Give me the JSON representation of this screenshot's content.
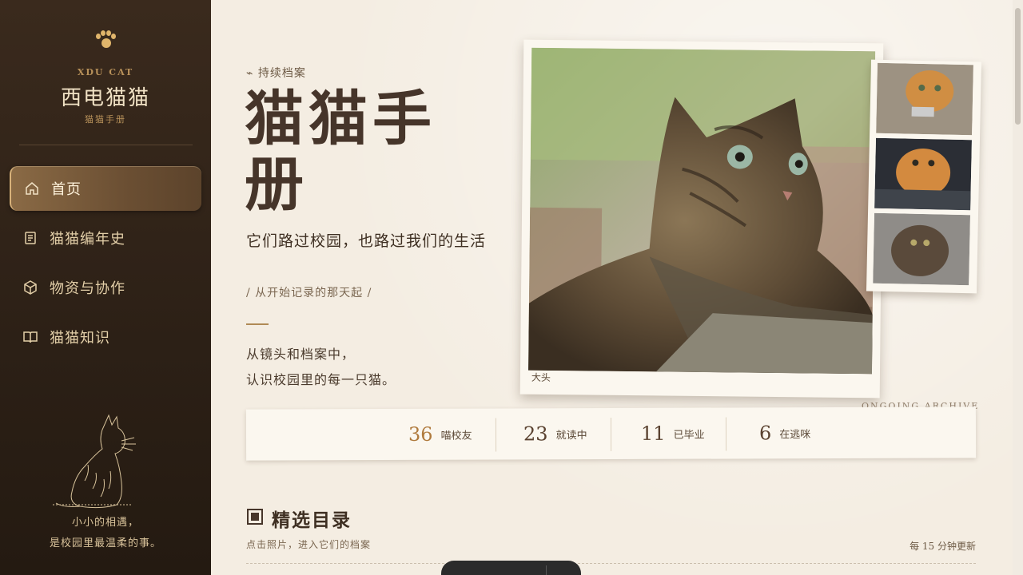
{
  "sidebar": {
    "brand_en": "XDU CAT",
    "brand_cn": "西电猫猫",
    "brand_sub": "猫猫手册",
    "nav": [
      {
        "label": "首页",
        "icon": "home-icon",
        "active": true
      },
      {
        "label": "猫猫编年史",
        "icon": "document-icon",
        "active": false
      },
      {
        "label": "物资与协作",
        "icon": "box-icon",
        "active": false
      },
      {
        "label": "猫猫知识",
        "icon": "book-icon",
        "active": false
      }
    ],
    "quote_line1": "小小的相遇，",
    "quote_line2": "是校园里最温柔的事。"
  },
  "hero": {
    "eyebrow": "⌁ 持续档案",
    "title": "猫猫手册",
    "subtitle": "它们路过校园，也路过我们的生活",
    "since": "/ 从开始记录的那天起 /",
    "desc_line1": "从镜头和档案中，",
    "desc_line2": "认识校园里的每一只猫。",
    "photo_caption": "大头",
    "archive_label": "ONGOING ARCHIVE"
  },
  "stats": [
    {
      "value": "36",
      "label": "喵校友"
    },
    {
      "value": "23",
      "label": "就读中"
    },
    {
      "value": "11",
      "label": "已毕业"
    },
    {
      "value": "6",
      "label": "在逃咪"
    }
  ],
  "section": {
    "title": "精选目录",
    "subtitle": "点击照片，进入它们的档案",
    "update_note": "每 15 分钟更新"
  },
  "colors": {
    "sidebar_bg": "#2c2016",
    "accent": "#b07b3e",
    "page_bg": "#f4ede2"
  }
}
